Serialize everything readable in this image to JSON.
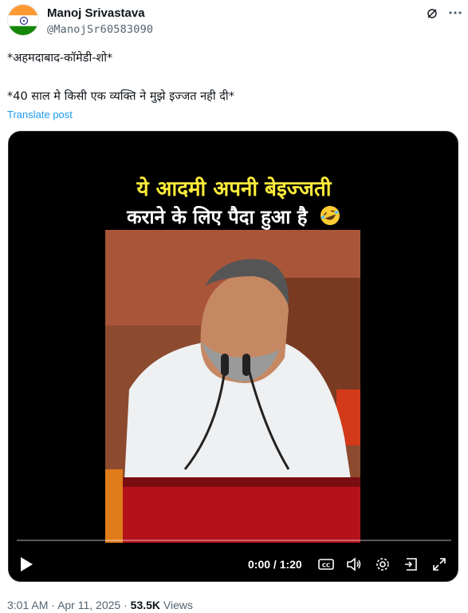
{
  "author": {
    "name": "Manoj Srivastava",
    "handle": "@ManojSr60583090"
  },
  "tweet": {
    "line1": "*अहमदाबाद-कॉमेडी-शो*",
    "line2": "*40 साल मे किसी एक व्यक्ति ने मुझे इज्जत नही दी*",
    "translate": "Translate post"
  },
  "video": {
    "caption_line1": "ये आदमी अपनी बेइज्जती",
    "caption_line2": "कराने के लिए पैदा हुआ है",
    "time": "0:00 / 1:20",
    "progress": 0.0
  },
  "meta": {
    "time": "3:01 AM",
    "date": "Apr 11, 2025",
    "views_count": "53.5K",
    "views_label": "Views",
    "separator": "·"
  },
  "colors": {
    "accent": "#1d9bf0",
    "caption_yellow": "#ffeb3b"
  }
}
